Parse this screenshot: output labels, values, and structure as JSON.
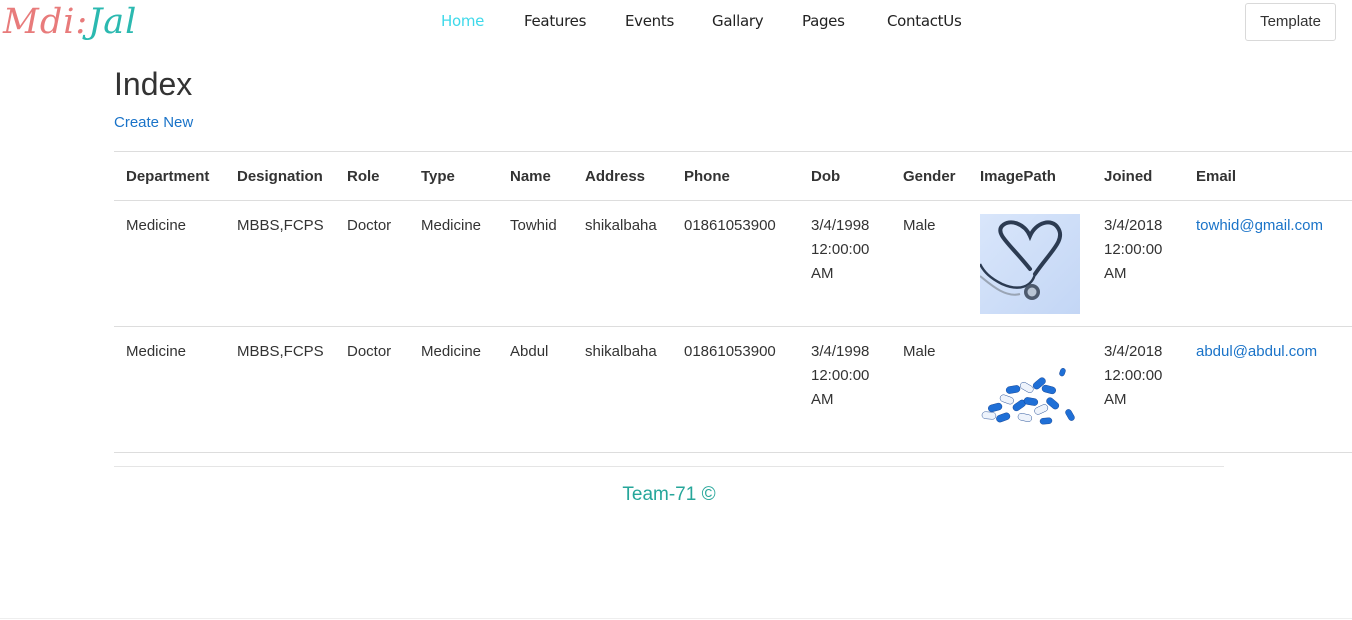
{
  "brand": {
    "part1": "Mdi:",
    "part2": "Jal"
  },
  "nav": {
    "items": [
      "Home",
      "Features",
      "Events",
      "Gallary",
      "Pages",
      "ContactUs"
    ],
    "active": "Home",
    "template_label": "Template"
  },
  "page": {
    "title": "Index",
    "create_new": "Create New"
  },
  "table": {
    "headers": [
      "Department",
      "Designation",
      "Role",
      "Type",
      "Name",
      "Address",
      "Phone",
      "Dob",
      "Gender",
      "ImagePath",
      "Joined",
      "Email"
    ],
    "rows": [
      {
        "department": "Medicine",
        "designation": "MBBS,FCPS",
        "role": "Doctor",
        "type": "Medicine",
        "name": "Towhid",
        "address": "shikalbaha",
        "phone": "01861053900",
        "dob": "3/4/1998 12:00:00 AM",
        "gender": "Male",
        "image": "stethoscope-heart-image",
        "joined": "3/4/2018 12:00:00 AM",
        "email": "towhid@gmail.com"
      },
      {
        "department": "Medicine",
        "designation": "MBBS,FCPS",
        "role": "Doctor",
        "type": "Medicine",
        "name": "Abdul",
        "address": "shikalbaha",
        "phone": "01861053900",
        "dob": "3/4/1998 12:00:00 AM",
        "gender": "Male",
        "image": "blue-capsules-image",
        "joined": "3/4/2018 12:00:00 AM",
        "email": "abdul@abdul.com"
      }
    ]
  },
  "footer": {
    "text": "Team-71 ©"
  },
  "colors": {
    "brand_pink": "#e87b7b",
    "brand_teal": "#2bb9b0",
    "nav_active": "#3fd9ea",
    "link": "#1a73c8",
    "footer": "#26a69a"
  }
}
